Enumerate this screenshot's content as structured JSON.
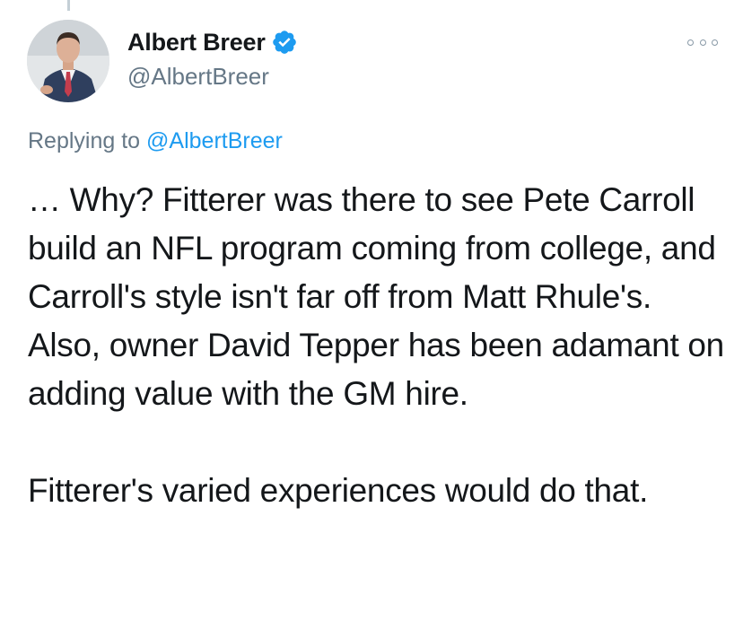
{
  "author": {
    "display_name": "Albert Breer",
    "handle": "@AlbertBreer",
    "verified": true,
    "avatar_icon": "profile-photo",
    "verified_color": "#1d9bf0"
  },
  "reply": {
    "prefix": "Replying to ",
    "mention": "@AlbertBreer"
  },
  "tweet": {
    "paragraphs": [
      "… Why? Fitterer was there to see Pete Carroll build an NFL program coming from college, and Carroll's style isn't far off from Matt Rhule's. Also, owner David Tepper has been adamant on adding value with the GM hire.",
      "Fitterer's varied experiences would do that."
    ]
  },
  "menu": {
    "icon": "more-options-icon"
  }
}
